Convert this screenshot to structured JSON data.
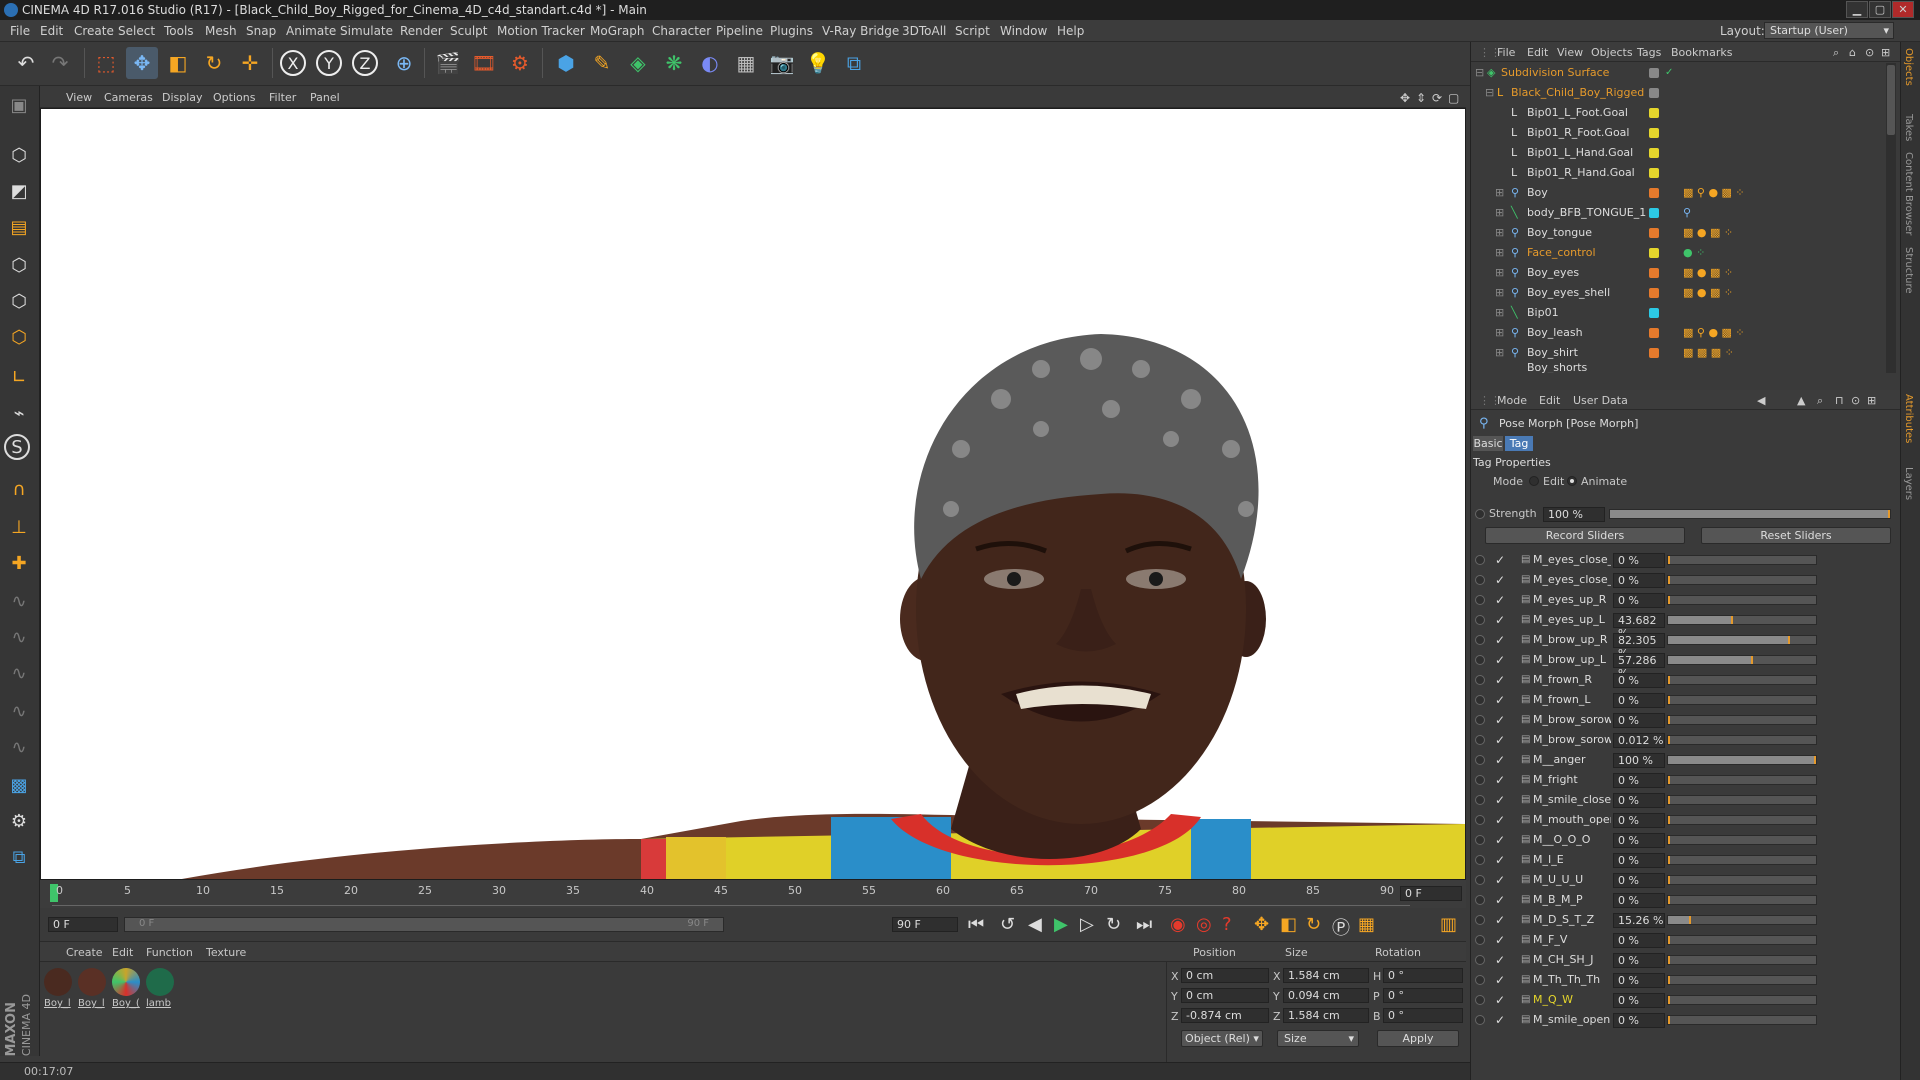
{
  "window": {
    "title": "CINEMA 4D R17.016 Studio (R17) - [Black_Child_Boy_Rigged_for_Cinema_4D_c4d_standart.c4d *] - Main"
  },
  "menu": [
    "File",
    "Edit",
    "Create",
    "Select",
    "Tools",
    "Mesh",
    "Snap",
    "Animate",
    "Simulate",
    "Render",
    "Sculpt",
    "Motion Tracker",
    "MoGraph",
    "Character",
    "Pipeline",
    "Plugins",
    "V-Ray Bridge",
    "3DToAll",
    "Script",
    "Window",
    "Help"
  ],
  "layout": {
    "label": "Layout:",
    "value": "Startup (User)"
  },
  "viewport_menu": [
    "View",
    "Cameras",
    "Display",
    "Options",
    "Filter",
    "Panel"
  ],
  "timeline": {
    "ticks": [
      "0",
      "5",
      "10",
      "15",
      "20",
      "25",
      "30",
      "35",
      "40",
      "45",
      "50",
      "55",
      "60",
      "65",
      "70",
      "75",
      "80",
      "85",
      "90"
    ],
    "current_frame": "0 F",
    "start_field": "0 F",
    "range_start": "0 F",
    "range_end": "90 F",
    "end_field": "90 F"
  },
  "material_panel": {
    "menu": [
      "Create",
      "Edit",
      "Function",
      "Texture"
    ],
    "materials": [
      {
        "label": "Boy_l",
        "color": "#4a2a20"
      },
      {
        "label": "Boy_l",
        "color": "#5a3025"
      },
      {
        "label": "Boy_(",
        "color": "#c9a42a"
      },
      {
        "label": "lamb",
        "color": "#1f6b4a"
      }
    ]
  },
  "coords": {
    "headers": [
      "Position",
      "Size",
      "Rotation"
    ],
    "rows": [
      {
        "axis": "X",
        "pos": "0 cm",
        "size_axis": "X",
        "size": "1.584 cm",
        "rot_axis": "H",
        "rot": "0 °"
      },
      {
        "axis": "Y",
        "pos": "0 cm",
        "size_axis": "Y",
        "size": "0.094 cm",
        "rot_axis": "P",
        "rot": "0 °"
      },
      {
        "axis": "Z",
        "pos": "-0.874 cm",
        "size_axis": "Z",
        "size": "1.584 cm",
        "rot_axis": "B",
        "rot": "0 °"
      }
    ],
    "mode_select": "Object (Rel)",
    "size_select": "Size",
    "apply_label": "Apply"
  },
  "status": {
    "time": "00:17:07"
  },
  "objects_panel": {
    "menu": [
      "File",
      "Edit",
      "View",
      "Objects",
      "Tags",
      "Bookmarks"
    ],
    "items": [
      {
        "name": "Subdivision Surface",
        "indent": 0,
        "color": "#e59a2c",
        "dot": "#888",
        "highlight": true
      },
      {
        "name": "Black_Child_Boy_Rigged",
        "indent": 1,
        "color": "#e59a2c",
        "dot": "#888",
        "highlight": true
      },
      {
        "name": "Bip01_L_Foot.Goal",
        "indent": 2,
        "color": "#ddd",
        "dot": "#e5d62c"
      },
      {
        "name": "Bip01_R_Foot.Goal",
        "indent": 2,
        "color": "#ddd",
        "dot": "#e5d62c"
      },
      {
        "name": "Bip01_L_Hand.Goal",
        "indent": 2,
        "color": "#ddd",
        "dot": "#e5d62c"
      },
      {
        "name": "Bip01_R_Hand.Goal",
        "indent": 2,
        "color": "#ddd",
        "dot": "#e5d62c"
      },
      {
        "name": "Boy",
        "indent": 2,
        "color": "#ddd",
        "dot": "#e57a2c"
      },
      {
        "name": "body_BFB_TONGUE_1",
        "indent": 2,
        "color": "#ddd",
        "dot": "#2cc9e5"
      },
      {
        "name": "Boy_tongue",
        "indent": 2,
        "color": "#ddd",
        "dot": "#e57a2c"
      },
      {
        "name": "Face_control",
        "indent": 2,
        "color": "#e59a2c",
        "dot": "#e5d62c"
      },
      {
        "name": "Boy_eyes",
        "indent": 2,
        "color": "#ddd",
        "dot": "#e57a2c"
      },
      {
        "name": "Boy_eyes_shell",
        "indent": 2,
        "color": "#ddd",
        "dot": "#e57a2c"
      },
      {
        "name": "Bip01",
        "indent": 2,
        "color": "#ddd",
        "dot": "#2cc9e5"
      },
      {
        "name": "Boy_leash",
        "indent": 2,
        "color": "#ddd",
        "dot": "#e57a2c"
      },
      {
        "name": "Boy_shirt",
        "indent": 2,
        "color": "#ddd",
        "dot": "#e57a2c"
      },
      {
        "name": "Boy_shorts",
        "indent": 2,
        "color": "#ddd",
        "dot": "#e57a2c"
      }
    ]
  },
  "attributes": {
    "menu": [
      "Mode",
      "Edit",
      "User Data"
    ],
    "title": "Pose Morph [Pose Morph]",
    "tabs": [
      "Basic",
      "Tag"
    ],
    "section": "Tag Properties",
    "mode_label": "Mode",
    "mode_edit": "Edit",
    "mode_animate": "Animate",
    "strength_label": "Strength",
    "strength_value": "100 %",
    "strength_fraction": 1.0,
    "record_label": "Record Sliders",
    "reset_label": "Reset Sliders",
    "sliders": [
      {
        "name": "M_eyes_close_R",
        "value": "0 %",
        "fraction": 0
      },
      {
        "name": "M_eyes_close_L",
        "value": "0 %",
        "fraction": 0
      },
      {
        "name": "M_eyes_up_R",
        "value": "0 %",
        "fraction": 0
      },
      {
        "name": "M_eyes_up_L",
        "value": "43.682 %",
        "fraction": 0.43682
      },
      {
        "name": "M_brow_up_R",
        "value": "82.305 %",
        "fraction": 0.82305
      },
      {
        "name": "M_brow_up_L",
        "value": "57.286 %",
        "fraction": 0.57286
      },
      {
        "name": "M_frown_R",
        "value": "0 %",
        "fraction": 0
      },
      {
        "name": "M_frown_L",
        "value": "0 %",
        "fraction": 0
      },
      {
        "name": "M_brow_sorow_R",
        "value": "0 %",
        "fraction": 0
      },
      {
        "name": "M_brow_sorow_L",
        "value": "0.012 %",
        "fraction": 0.00012
      },
      {
        "name": "M__anger",
        "value": "100 %",
        "fraction": 1.0
      },
      {
        "name": "M_fright",
        "value": "0 %",
        "fraction": 0
      },
      {
        "name": "M_smile_close",
        "value": "0 %",
        "fraction": 0
      },
      {
        "name": "M_mouth_open",
        "value": "0 %",
        "fraction": 0
      },
      {
        "name": "M__O_O_O",
        "value": "0 %",
        "fraction": 0
      },
      {
        "name": "M_I_E",
        "value": "0 %",
        "fraction": 0
      },
      {
        "name": "M_U_U_U",
        "value": "0 %",
        "fraction": 0
      },
      {
        "name": "M_B_M_P",
        "value": "0 %",
        "fraction": 0
      },
      {
        "name": "M_D_S_T_Z",
        "value": "15.26 %",
        "fraction": 0.1526
      },
      {
        "name": "M_F_V",
        "value": "0 %",
        "fraction": 0
      },
      {
        "name": "M_CH_SH_J",
        "value": "0 %",
        "fraction": 0
      },
      {
        "name": "M_Th_Th_Th",
        "value": "0 %",
        "fraction": 0
      },
      {
        "name": "M_Q_W",
        "value": "0 %",
        "fraction": 0,
        "highlight": true
      },
      {
        "name": "M_smile_open",
        "value": "0 %",
        "fraction": 0
      }
    ]
  },
  "side_tabs": [
    "Objects",
    "Takes",
    "Content Browser",
    "Structure",
    "Attributes",
    "Layers"
  ],
  "brand": {
    "maxon": "MAXON",
    "product": "CINEMA 4D"
  }
}
